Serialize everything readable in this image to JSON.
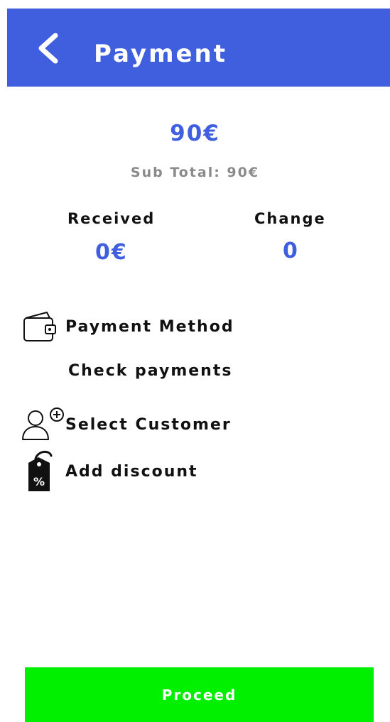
{
  "header": {
    "title": "Payment",
    "back_icon": "chevron-left-icon",
    "background_color": "#3f5fde"
  },
  "totals": {
    "total": "90€",
    "subtotal": "Sub Total: 90€"
  },
  "summary": {
    "received_label": "Received",
    "received_value": "0€",
    "change_label": "Change",
    "change_value": "0"
  },
  "menu": {
    "payment_method": {
      "label": "Payment Method",
      "icon": "wallet-icon"
    },
    "check_payments": {
      "label": "Check payments"
    },
    "select_customer": {
      "label": "Select Customer",
      "icon": "add-user-icon"
    },
    "add_discount": {
      "label": "Add discount",
      "icon": "discount-tag-icon"
    }
  },
  "footer": {
    "proceed_label": "Proceed",
    "proceed_color": "#00f000"
  }
}
